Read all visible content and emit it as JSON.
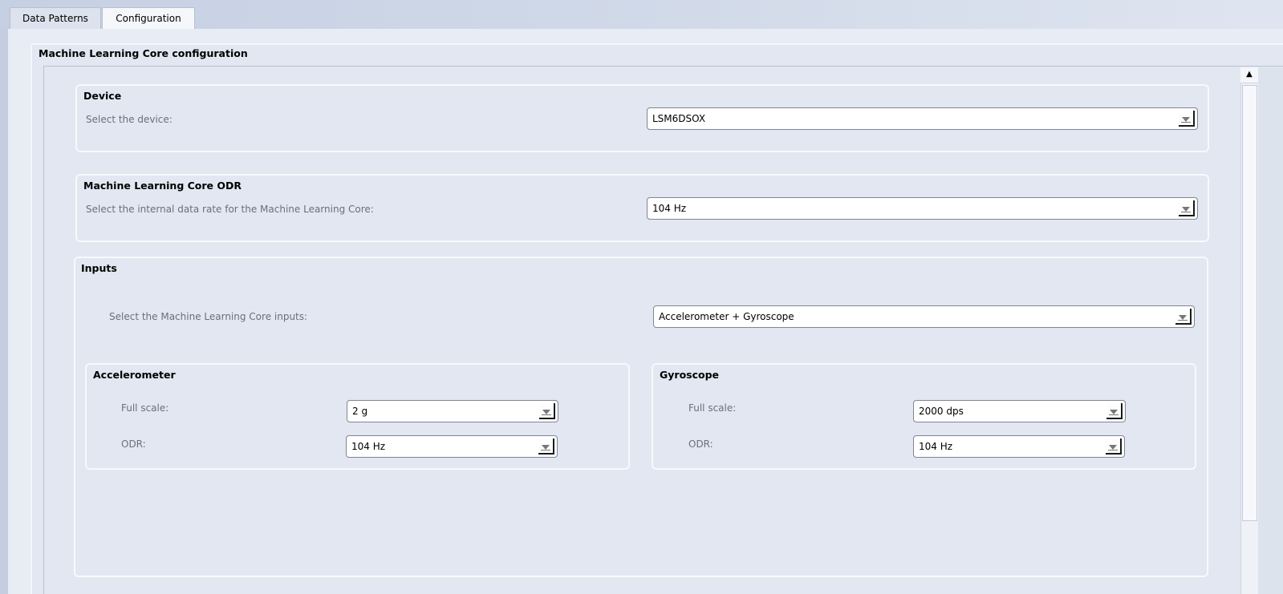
{
  "tabs": [
    {
      "label": "Data Patterns",
      "active": false
    },
    {
      "label": "Configuration",
      "active": true
    }
  ],
  "mlc": {
    "title": "Machine Learning Core configuration",
    "device": {
      "title": "Device",
      "label": "Select the device:",
      "value": "LSM6DSOX"
    },
    "odr": {
      "title": "Machine Learning Core ODR",
      "label": "Select the internal data rate for the Machine Learning Core:",
      "value": "104 Hz"
    },
    "inputs": {
      "title": "Inputs",
      "label": "Select the Machine Learning Core inputs:",
      "value": "Accelerometer + Gyroscope",
      "accelerometer": {
        "title": "Accelerometer",
        "full_scale_label": "Full scale:",
        "full_scale_value": "2 g",
        "odr_label": "ODR:",
        "odr_value": "104 Hz"
      },
      "gyroscope": {
        "title": "Gyroscope",
        "full_scale_label": "Full scale:",
        "full_scale_value": "2000 dps",
        "odr_label": "ODR:",
        "odr_value": "104 Hz"
      }
    }
  },
  "colors": {
    "background": "#dbe2ee",
    "panel": "#e2e7f1",
    "group_border": "#f7f9fc",
    "label_text": "#6b6f78"
  },
  "icons": {
    "dropdown": "chevron-down-icon",
    "scroll_up": "scroll-up-arrow-icon"
  }
}
